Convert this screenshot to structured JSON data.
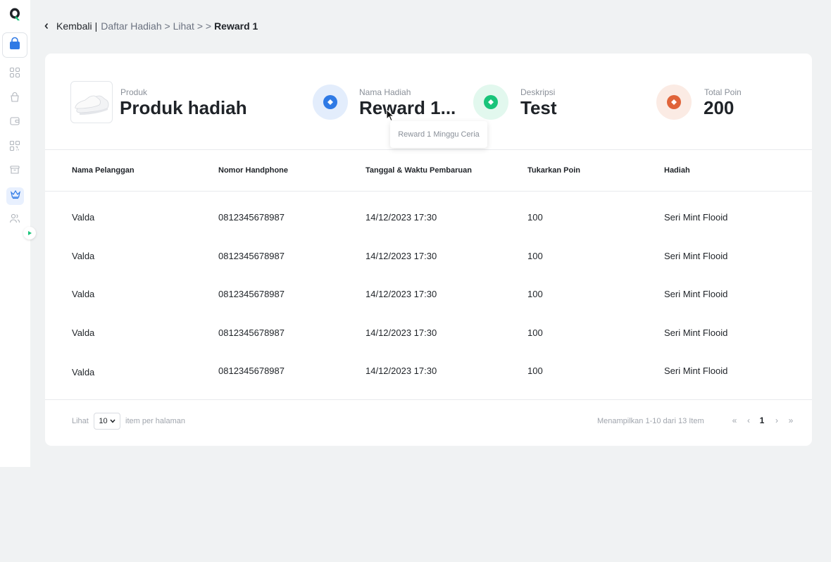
{
  "breadcrumb": {
    "back_label": "Kembali",
    "separator": "|",
    "path": "Daftar Hadiah > Lihat >  > ",
    "current": "Reward 1"
  },
  "summary": {
    "produk": {
      "label": "Produk",
      "value": "Produk hadiah"
    },
    "nama_hadiah": {
      "label": "Nama Hadiah",
      "value": "Reward 1...",
      "tooltip": "Reward 1 Minggu Ceria",
      "icon_color": "#2f7ae5"
    },
    "deskripsi": {
      "label": "Deskripsi",
      "value": "Test",
      "icon_color": "#19c47a"
    },
    "total_poin": {
      "label": "Total Poin",
      "value": "200",
      "icon_color": "#e0643a"
    }
  },
  "table": {
    "headers": [
      "Nama Pelanggan",
      "Nomor Handphone",
      "Tanggal & Waktu Pembaruan",
      "Tukarkan Poin",
      "Hadiah"
    ],
    "rows": [
      [
        "Valda",
        "0812345678987",
        "14/12/2023 17:30",
        "100",
        "Seri Mint Flooid"
      ],
      [
        "Valda",
        "0812345678987",
        "14/12/2023 17:30",
        "100",
        "Seri Mint Flooid"
      ],
      [
        "Valda",
        "0812345678987",
        "14/12/2023 17:30",
        "100",
        "Seri Mint Flooid"
      ],
      [
        "Valda",
        "0812345678987",
        "14/12/2023 17:30",
        "100",
        "Seri Mint Flooid"
      ],
      [
        "Valda",
        "0812345678987",
        "14/12/2023 17:30",
        "100",
        "Seri Mint Flooid"
      ]
    ]
  },
  "footer": {
    "show_label": "Lihat",
    "page_size": "10",
    "per_page_label": "item per halaman",
    "range_text": "Menampilkan 1-10 dari 13 Item",
    "first": "«",
    "prev": "‹",
    "current_page": "1",
    "next": "›",
    "last": "»"
  },
  "sidebar": {
    "icons": [
      "logo-icon",
      "shopping-bag-icon",
      "grid-icon",
      "bag-icon",
      "wallet-icon",
      "qr-icon",
      "archive-icon",
      "crown-icon",
      "users-icon"
    ]
  },
  "colors": {
    "accent": "#2f7ae5",
    "active_bg": "#e8f0fe",
    "expand": "#19c47a"
  }
}
